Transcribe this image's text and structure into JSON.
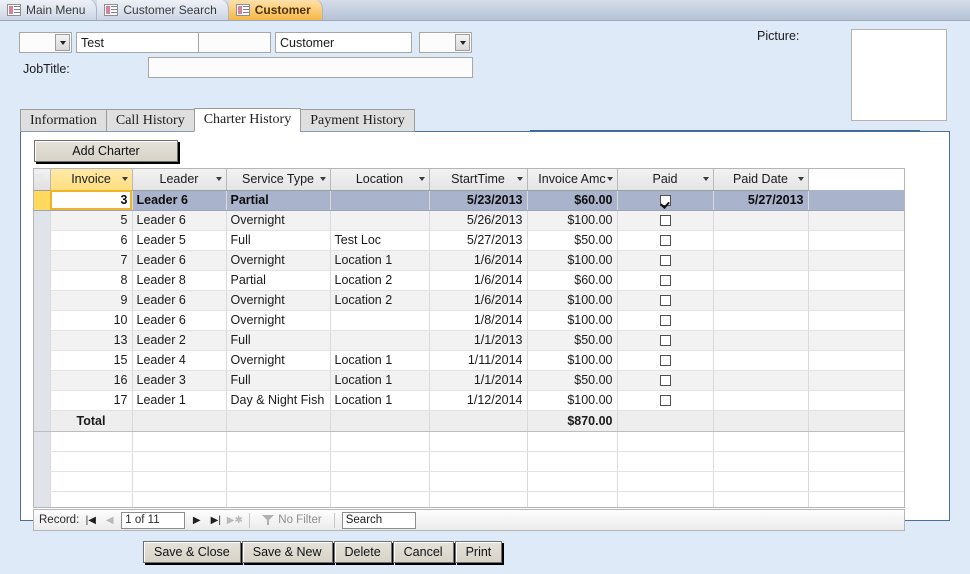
{
  "doc_tabs": [
    {
      "label": "Main Menu",
      "icon": "form-icon",
      "active": false
    },
    {
      "label": "Customer Search",
      "icon": "form-icon",
      "active": false
    },
    {
      "label": "Customer",
      "icon": "form-icon",
      "active": true
    }
  ],
  "header": {
    "title_combo_value": "",
    "first_name": "Test",
    "middle_name": "",
    "last_name": "Customer",
    "suffix_combo_value": "",
    "jobtitle_label": "JobTitle:",
    "jobtitle_value": "",
    "picture_label": "Picture:"
  },
  "tabs": [
    {
      "label": "Information",
      "active": false
    },
    {
      "label": "Call History",
      "active": false
    },
    {
      "label": "Charter History",
      "active": true
    },
    {
      "label": "Payment History",
      "active": false
    }
  ],
  "toolbar": {
    "add_charter_label": "Add Charter"
  },
  "grid": {
    "columns": [
      "Invoice",
      "Leader",
      "Service Type",
      "Location",
      "StartTime",
      "Invoice Amc",
      "Paid",
      "Paid Date"
    ],
    "sorted_column": "Invoice",
    "rows": [
      {
        "invoice": "3",
        "leader": "Leader 6",
        "service": "Partial",
        "location": "",
        "start": "5/23/2013",
        "amount": "$60.00",
        "paid": true,
        "paid_date": "5/27/2013"
      },
      {
        "invoice": "5",
        "leader": "Leader 6",
        "service": "Overnight",
        "location": "",
        "start": "5/26/2013",
        "amount": "$100.00",
        "paid": false,
        "paid_date": ""
      },
      {
        "invoice": "6",
        "leader": "Leader 5",
        "service": "Full",
        "location": "Test Loc",
        "start": "5/27/2013",
        "amount": "$50.00",
        "paid": false,
        "paid_date": ""
      },
      {
        "invoice": "7",
        "leader": "Leader 6",
        "service": "Overnight",
        "location": "Location 1",
        "start": "1/6/2014",
        "amount": "$100.00",
        "paid": false,
        "paid_date": ""
      },
      {
        "invoice": "8",
        "leader": "Leader 8",
        "service": "Partial",
        "location": "Location 2",
        "start": "1/6/2014",
        "amount": "$60.00",
        "paid": false,
        "paid_date": ""
      },
      {
        "invoice": "9",
        "leader": "Leader 6",
        "service": "Overnight",
        "location": "Location 2",
        "start": "1/6/2014",
        "amount": "$100.00",
        "paid": false,
        "paid_date": ""
      },
      {
        "invoice": "10",
        "leader": "Leader 6",
        "service": "Overnight",
        "location": "",
        "start": "1/8/2014",
        "amount": "$100.00",
        "paid": false,
        "paid_date": ""
      },
      {
        "invoice": "13",
        "leader": "Leader 2",
        "service": "Full",
        "location": "",
        "start": "1/1/2013",
        "amount": "$50.00",
        "paid": false,
        "paid_date": ""
      },
      {
        "invoice": "15",
        "leader": "Leader 4",
        "service": "Overnight",
        "location": "Location 1",
        "start": "1/11/2014",
        "amount": "$100.00",
        "paid": false,
        "paid_date": ""
      },
      {
        "invoice": "16",
        "leader": "Leader 3",
        "service": "Full",
        "location": "Location 1",
        "start": "1/1/2014",
        "amount": "$50.00",
        "paid": false,
        "paid_date": ""
      },
      {
        "invoice": "17",
        "leader": "Leader 1",
        "service": "Day & Night Fish",
        "location": "Location 1",
        "start": "1/12/2014",
        "amount": "$100.00",
        "paid": false,
        "paid_date": ""
      }
    ],
    "total_label": "Total",
    "total_amount": "$870.00",
    "selected_row_index": 0
  },
  "navigator": {
    "record_label": "Record:",
    "position": "1 of 11",
    "filter_label": "No Filter",
    "search_placeholder": "Search",
    "search_value": "Search"
  },
  "footer_buttons": [
    {
      "label": "Save & Close"
    },
    {
      "label": "Save & New"
    },
    {
      "label": "Delete"
    },
    {
      "label": "Cancel"
    },
    {
      "label": "Print"
    }
  ],
  "colors": {
    "accent_blue": "#336699",
    "active_tab_orange": "#f6b748",
    "selection_blue": "#aab3cc",
    "sort_yellow": "#ffdf7f",
    "form_background": "#dfeaf8"
  }
}
